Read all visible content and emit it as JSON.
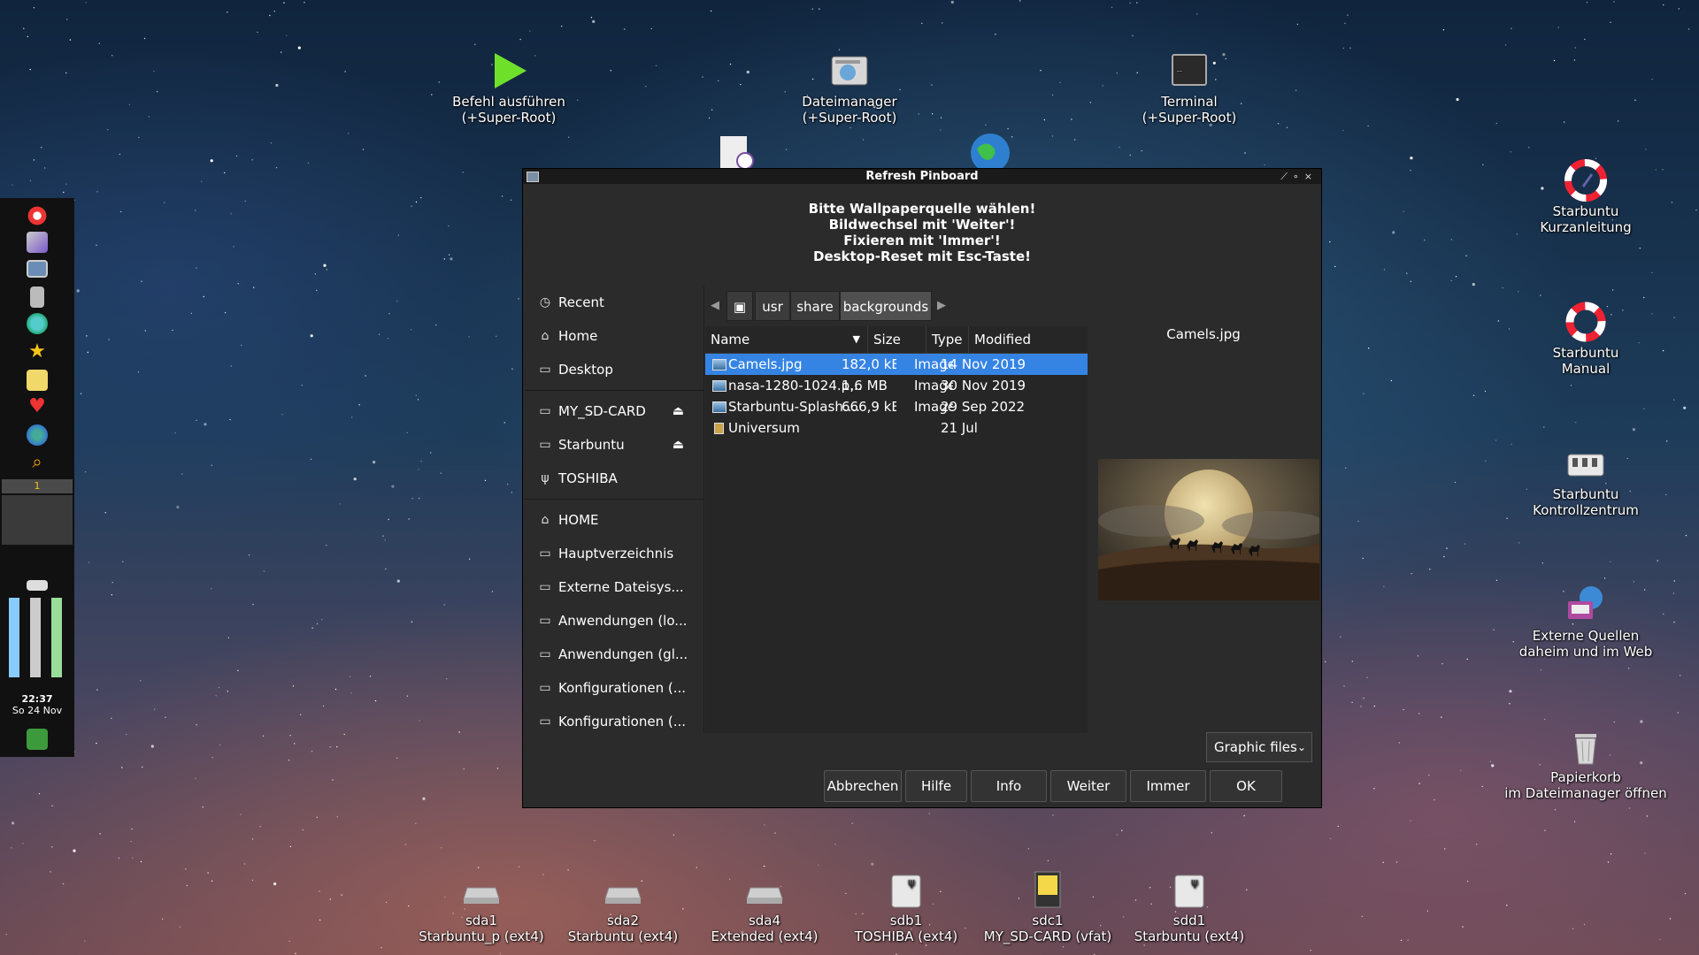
{
  "desktop": {
    "top_icons": [
      {
        "line1": "Befehl ausführen",
        "line2": "(+Super-Root)"
      },
      {
        "line1": "Dateimanager",
        "line2": "(+Super-Root)"
      },
      {
        "line1": "Terminal",
        "line2": "(+Super-Root)"
      }
    ],
    "right_icons": [
      {
        "line1": "Starbuntu",
        "line2": "Kurzanleitung"
      },
      {
        "line1": "Starbuntu",
        "line2": "Manual"
      },
      {
        "line1": "Starbuntu",
        "line2": "Kontrollzentrum"
      },
      {
        "line1": "Externe Quellen",
        "line2": "daheim und im Web"
      },
      {
        "line1": "Papierkorb",
        "line2": "im Dateimanager öffnen"
      }
    ],
    "drives": [
      {
        "line1": "sda1",
        "line2": "Starbuntu_p (ext4)"
      },
      {
        "line1": "sda2",
        "line2": "Starbuntu (ext4)"
      },
      {
        "line1": "sda4",
        "line2": "Extended (ext4)"
      },
      {
        "line1": "sdb1",
        "line2": "TOSHIBA (ext4)"
      },
      {
        "line1": "sdc1",
        "line2": "MY_SD-CARD (vfat)"
      },
      {
        "line1": "sdd1",
        "line2": "Starbuntu (ext4)"
      }
    ]
  },
  "panel": {
    "workspace": "1",
    "clock_time": "22:37",
    "clock_date": "So 24 Nov"
  },
  "dialog": {
    "title": "Refresh Pinboard",
    "message": [
      "Bitte Wallpaperquelle wählen!",
      "Bildwechsel mit 'Weiter'!",
      "Fixieren mit 'Immer'!",
      "Desktop-Reset mit Esc-Taste!"
    ],
    "sidebar": [
      {
        "label": "Recent",
        "icon": "clock-icon"
      },
      {
        "label": "Home",
        "icon": "home-icon"
      },
      {
        "label": "Desktop",
        "icon": "folder-icon"
      },
      {
        "label": "MY_SD-CARD",
        "icon": "drive-icon"
      },
      {
        "label": "Starbuntu",
        "icon": "drive-icon"
      },
      {
        "label": "TOSHIBA",
        "icon": "usb-icon"
      },
      {
        "label": "HOME",
        "icon": "home-icon"
      },
      {
        "label": "Hauptverzeichnis",
        "icon": "folder-icon"
      },
      {
        "label": "Externe Dateisys...",
        "icon": "folder-icon"
      },
      {
        "label": "Anwendungen (lo...",
        "icon": "folder-icon"
      },
      {
        "label": "Anwendungen (gl...",
        "icon": "folder-icon"
      },
      {
        "label": "Konfigurationen (...",
        "icon": "folder-icon"
      },
      {
        "label": "Konfigurationen (...",
        "icon": "folder-icon"
      }
    ],
    "path": [
      "usr",
      "share",
      "backgrounds"
    ],
    "columns": {
      "name": "Name",
      "size": "Size",
      "type": "Type",
      "modified": "Modified"
    },
    "files": [
      {
        "name": "Camels.jpg",
        "size": "182,0 kB",
        "type": "Image",
        "modified": "14 Nov 2019",
        "selected": true
      },
      {
        "name": "nasa-1280-1024.p...",
        "size": "1,6 MB",
        "type": "Image",
        "modified": "30 Nov 2019"
      },
      {
        "name": "Starbuntu-Splash....",
        "size": "666,9 kB",
        "type": "Image",
        "modified": "29 Sep 2022"
      },
      {
        "name": "Universum",
        "size": "",
        "type": "",
        "modified": "21 Jul"
      }
    ],
    "preview_title": "Camels.jpg",
    "filter": "Graphic files",
    "buttons": {
      "cancel": "Abbrechen",
      "help": "Hilfe",
      "info": "Info",
      "next": "Weiter",
      "always": "Immer",
      "ok": "OK"
    }
  }
}
